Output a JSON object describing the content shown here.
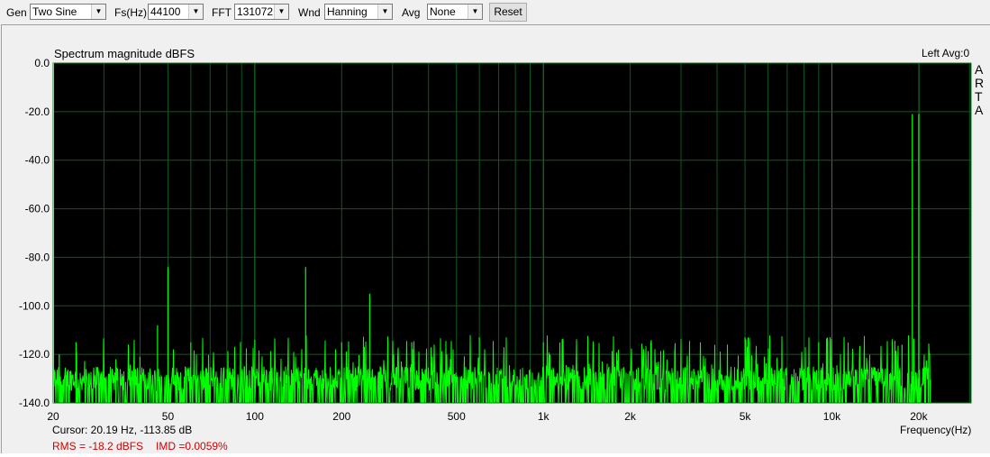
{
  "toolbar": {
    "gen_label": "Gen",
    "gen_value": "Two Sine",
    "fs_label": "Fs(Hz)",
    "fs_value": "44100",
    "fft_label": "FFT",
    "fft_value": "131072",
    "wnd_label": "Wnd",
    "wnd_value": "Hanning",
    "avg_label": "Avg",
    "avg_value": "None",
    "reset_label": "Reset"
  },
  "status": {
    "channel": "Left  Avg:0",
    "brand": [
      "A",
      "R",
      "T",
      "A"
    ],
    "cursor": "Cursor: 20.19 Hz, -113.85 dB",
    "rms": "RMS =  -18.2 dBFS",
    "imd": "IMD =0.0059%"
  },
  "colors": {
    "trace": "#00ff00",
    "grid": "#0e5a1e",
    "grid_major": "#1a8a2a",
    "background": "#000000"
  },
  "chart_data": {
    "type": "line",
    "title": "Spectrum magnitude dBFS",
    "xlabel": "Frequency(Hz)",
    "ylabel": "dBFS",
    "xscale": "log",
    "xlim": [
      20,
      30000
    ],
    "ylim": [
      -140,
      0
    ],
    "yticks": [
      0,
      -20,
      -40,
      -60,
      -80,
      -100,
      -120,
      -140
    ],
    "ytick_labels": [
      "0.0",
      "-20.0",
      "-40.0",
      "-60.0",
      "-80.0",
      "-100.0",
      "-120.0",
      "-140.0"
    ],
    "xticks": [
      20,
      50,
      100,
      200,
      500,
      1000,
      2000,
      5000,
      10000,
      20000
    ],
    "xtick_labels": [
      "20",
      "50",
      "100",
      "200",
      "500",
      "1k",
      "2k",
      "5k",
      "10k",
      "20k"
    ],
    "grid": true,
    "noise_floor": {
      "from_hz": 20,
      "to_hz": 22050,
      "low_db": -140,
      "typical_db": -130,
      "high_db": -115
    },
    "peaks": [
      {
        "hz": 21,
        "db": -120
      },
      {
        "hz": 24,
        "db": -115
      },
      {
        "hz": 33,
        "db": -122
      },
      {
        "hz": 40,
        "db": -121
      },
      {
        "hz": 46,
        "db": -108
      },
      {
        "hz": 50,
        "db": -84
      },
      {
        "hz": 60,
        "db": -115
      },
      {
        "hz": 100,
        "db": -114
      },
      {
        "hz": 150,
        "db": -84
      },
      {
        "hz": 200,
        "db": -115
      },
      {
        "hz": 250,
        "db": -95
      },
      {
        "hz": 350,
        "db": -115
      },
      {
        "hz": 600,
        "db": -113
      },
      {
        "hz": 1000,
        "db": -115
      },
      {
        "hz": 5000,
        "db": -113
      },
      {
        "hz": 9000,
        "db": -115
      },
      {
        "hz": 17500,
        "db": -116
      },
      {
        "hz": 19000,
        "db": -21
      },
      {
        "hz": 20000,
        "db": -21
      }
    ]
  }
}
